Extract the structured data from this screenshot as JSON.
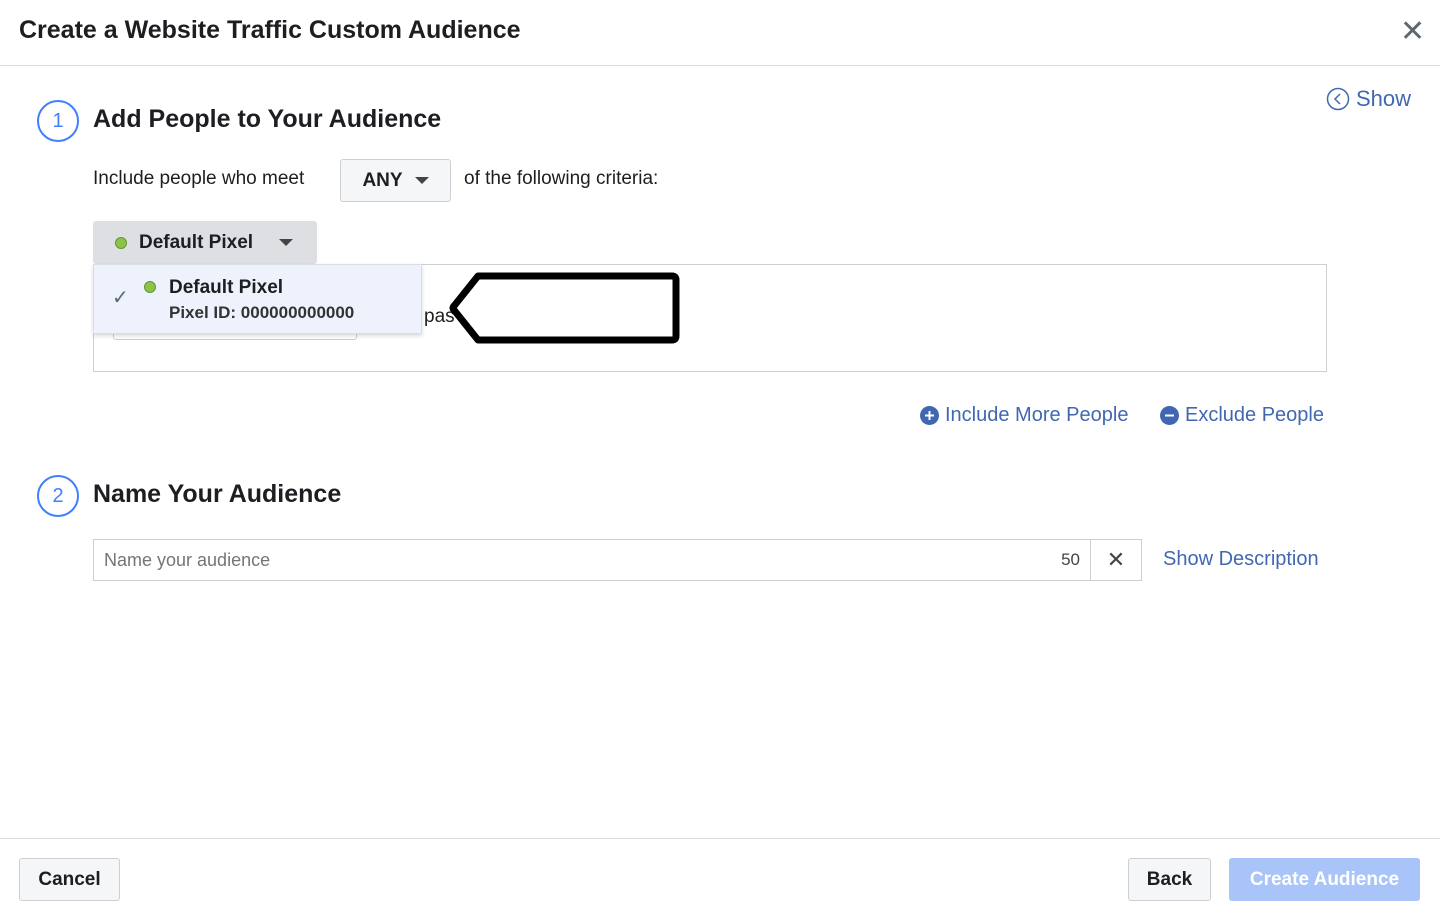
{
  "dialog": {
    "title": "Create a Website Traffic Custom Audience",
    "close_icon": "close-icon"
  },
  "show_link": "Show",
  "step1": {
    "number": "1",
    "title": "Add People to Your Audience",
    "include_prefix": "Include people who meet",
    "match_value": "ANY",
    "include_suffix": "of the following criteria:",
    "pixel_selector": "Default Pixel",
    "dropdown": {
      "name": "Default Pixel",
      "pixel_id": "Pixel ID: 000000000000"
    },
    "partial_text": "pas",
    "include_more": "Include More People",
    "exclude": "Exclude People"
  },
  "step2": {
    "number": "2",
    "title": "Name Your Audience",
    "name_placeholder": "Name your audience",
    "name_value": "",
    "char_count": "50",
    "show_description": "Show Description"
  },
  "footer": {
    "cancel": "Cancel",
    "back": "Back",
    "create": "Create Audience"
  },
  "colors": {
    "accent": "#4080ff",
    "link": "#4267b2",
    "create_disabled": "#a9c4f8",
    "pixel_status": "#8bc34a"
  }
}
